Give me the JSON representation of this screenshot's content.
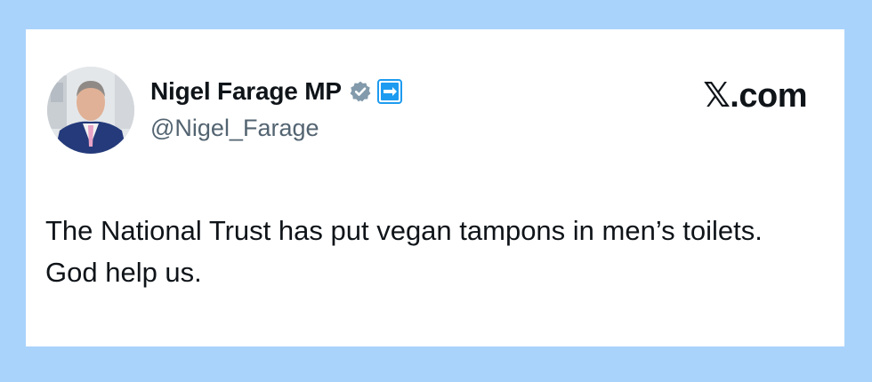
{
  "tweet": {
    "author": {
      "display_name": "Nigel Farage MP",
      "handle": "@Nigel_Farage",
      "avatar_icon": "profile-photo",
      "verified_icon": "verified-badge-icon",
      "affiliate_icon": "affiliate-badge-icon"
    },
    "site_label": "𝕏.com",
    "text": "The National Trust has put vegan tampons in men’s toilets. God help us."
  },
  "colors": {
    "page_background": "#a9d3fb",
    "card_background": "#ffffff",
    "primary_text": "#0f1419",
    "secondary_text": "#536471",
    "verified_badge": "#829aab",
    "affiliate_badge": "#1d9bf0"
  }
}
